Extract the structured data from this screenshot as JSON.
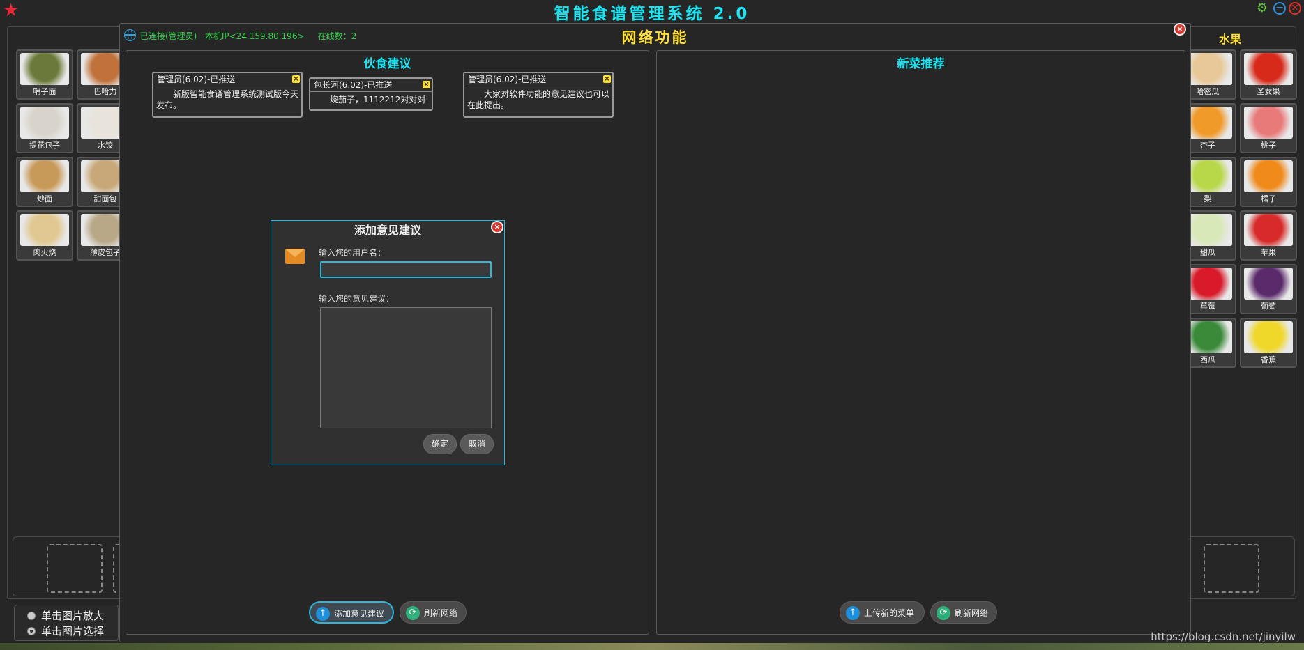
{
  "app": {
    "title": "智能食谱管理系统 2.0"
  },
  "left_panel": {
    "items": [
      {
        "label": "哨子面",
        "color": "#6b7a3a"
      },
      {
        "label": "巴哈力",
        "color": "#c0723a"
      },
      {
        "label": "提花包子",
        "color": "#d8d4cc"
      },
      {
        "label": "水饺",
        "color": "#e8e4dc"
      },
      {
        "label": "炒面",
        "color": "#c89a5a"
      },
      {
        "label": "甜面包",
        "color": "#c8a878"
      },
      {
        "label": "肉火烧",
        "color": "#e0c890"
      },
      {
        "label": "薄皮包子",
        "color": "#b8a888"
      }
    ]
  },
  "right_panel": {
    "title": "水果",
    "items": [
      {
        "label": "哈密瓜",
        "color": "#e8c898"
      },
      {
        "label": "圣女果",
        "color": "#d82a1a"
      },
      {
        "label": "杏子",
        "color": "#f09a2a"
      },
      {
        "label": "桃子",
        "color": "#e87a7a"
      },
      {
        "label": "梨",
        "color": "#b8d84a"
      },
      {
        "label": "橘子",
        "color": "#f08a1a"
      },
      {
        "label": "甜瓜",
        "color": "#d8e8b8"
      },
      {
        "label": "苹果",
        "color": "#d82a2a"
      },
      {
        "label": "草莓",
        "color": "#d81a2a"
      },
      {
        "label": "葡萄",
        "color": "#5a2a6a"
      },
      {
        "label": "西瓜",
        "color": "#3a8a3a"
      },
      {
        "label": "香蕉",
        "color": "#f0d82a"
      }
    ]
  },
  "view_mode": {
    "options": [
      "单击图片放大",
      "单击图片选择"
    ],
    "selected": "单击图片选择"
  },
  "network": {
    "title": "网络功能",
    "status": {
      "connection": "已连接(管理员)",
      "ip": "本机IP<24.159.80.196>",
      "online": "在线数：2"
    },
    "suggestions": {
      "title": "伙食建议",
      "notes": [
        {
          "header": "管理员(6.02)-已推送",
          "body": "新版智能食谱管理系统测试版今天发布。"
        },
        {
          "header": "包长河(6.02)-已推送",
          "body": "烧茄子，1112212对对对"
        },
        {
          "header": "管理员(6.02)-已推送",
          "body": "大家对软件功能的意见建议也可以在此提出。"
        }
      ],
      "add_button": "添加意见建议",
      "refresh_button": "刷新网络"
    },
    "recommend": {
      "title": "新菜推荐",
      "upload_button": "上传新的菜单",
      "refresh_button": "刷新网络"
    }
  },
  "dialog": {
    "title": "添加意见建议",
    "username_label": "输入您的用户名：",
    "username_value": "",
    "suggestion_label": "输入您的意见建议：",
    "suggestion_value": "",
    "ok_button": "确定",
    "cancel_button": "取消"
  },
  "watermark": "https://blog.csdn.net/jinyilw"
}
